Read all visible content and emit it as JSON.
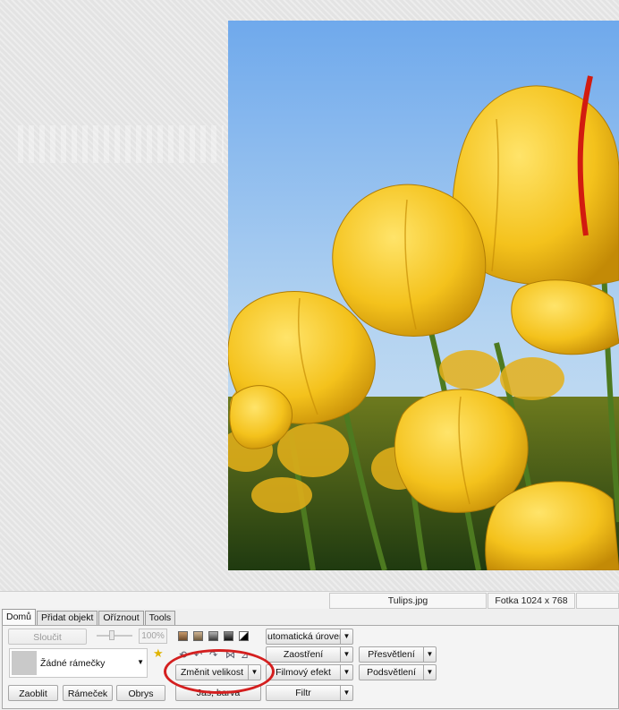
{
  "status": {
    "filename": "Tulips.jpg",
    "photo_info": "Fotka 1024 x 768"
  },
  "tabs": [
    {
      "label": "Domů"
    },
    {
      "label": "Přidat objekt"
    },
    {
      "label": "Oříznout"
    },
    {
      "label": "Tools"
    }
  ],
  "panel": {
    "merge_label": "Sloučit",
    "zoom_percent": "100%",
    "frame_label": "Žádné rámečky",
    "round_label": "Zaoblit",
    "frame_button": "Rámeček",
    "outline_label": "Obrys",
    "resize_label": "Změnit velikost",
    "brightness_label": "Jas, barva",
    "auto_level_label": "utomatická úroveň",
    "sharpen_label": "Zaostření",
    "film_effect_label": "Filmový efekt",
    "filter_label": "Filtr",
    "overexpose_label": "Přesvětlení",
    "backlight_label": "Podsvětlení"
  },
  "icons": {
    "star": "star-icon",
    "rotate_left": "rotate-left-icon",
    "rotate_right": "rotate-right-icon",
    "flip": "flip-icon",
    "dropdown": "chevron-down-icon"
  },
  "colors": {
    "annotation": "#d41f1f",
    "star": "#e0b400"
  }
}
